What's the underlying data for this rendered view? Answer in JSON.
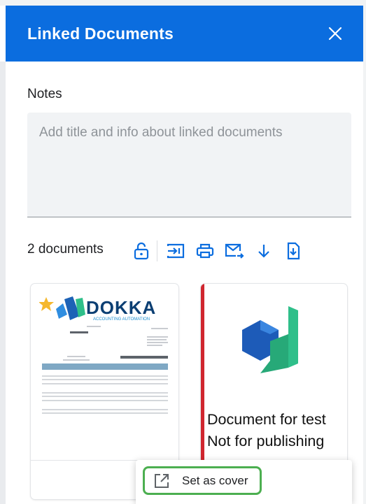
{
  "header": {
    "title": "Linked Documents"
  },
  "notes": {
    "label": "Notes",
    "placeholder": "Add title and info about linked documents",
    "value": ""
  },
  "documents": {
    "count_label": "2 documents",
    "toolbar": [
      "lock-icon",
      "import-icon",
      "print-icon",
      "email-forward-icon",
      "download-icon",
      "save-to-document-icon"
    ],
    "items": [
      {
        "logo_text": "DOKKA",
        "logo_subtitle": "ACCOUNTING AUTOMATION"
      },
      {
        "lines": [
          "Document for test",
          "Not for publishing"
        ]
      }
    ]
  },
  "context_menu": {
    "items": [
      {
        "label": "Set as cover",
        "icon": "open-external-icon"
      }
    ]
  },
  "colors": {
    "header": "#0b6ddf",
    "icon": "#0b6ddf",
    "highlight": "#4caf50",
    "accent": "#d0262f"
  }
}
